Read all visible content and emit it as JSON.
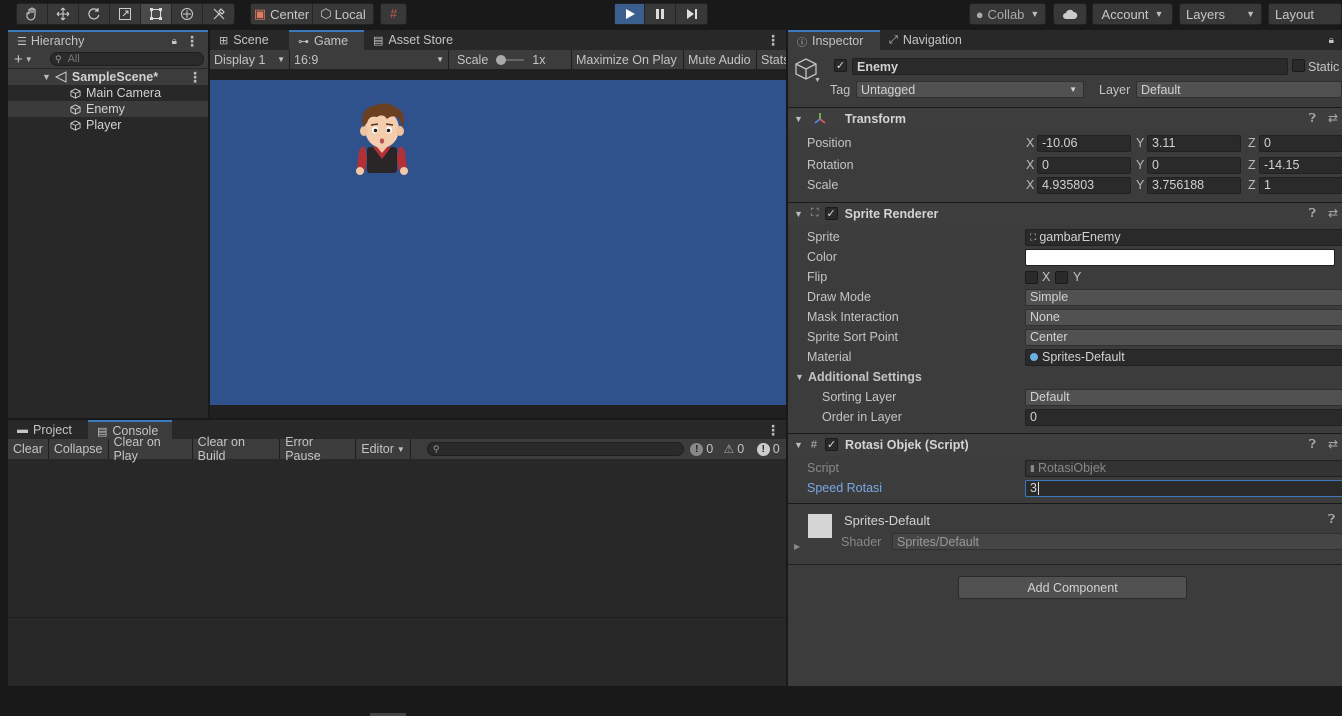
{
  "toolbar": {
    "pivot": "Center",
    "space": "Local",
    "collab": "Collab",
    "account": "Account",
    "layers": "Layers",
    "layout": "Layout"
  },
  "hierarchy": {
    "tab": "Hierarchy",
    "search_placeholder": "All",
    "scene": "SampleScene*",
    "items": [
      "Main Camera",
      "Enemy",
      "Player"
    ]
  },
  "center_tabs": [
    "Scene",
    "Game",
    "Asset Store"
  ],
  "game_bar": {
    "display": "Display 1",
    "aspect": "16:9",
    "scale_label": "Scale",
    "scale_value": "1x",
    "maximize": "Maximize On Play",
    "mute": "Mute Audio",
    "stats": "Stats"
  },
  "game_view": {
    "background": "#30528c"
  },
  "bottom_tabs": [
    "Project",
    "Console"
  ],
  "console_toolbar": {
    "clear": "Clear",
    "collapse": "Collapse",
    "clear_on_play": "Clear on Play",
    "clear_on_build": "Clear on Build",
    "error_pause": "Error Pause",
    "editor": "Editor",
    "count_info": "0",
    "count_warn": "0",
    "count_error": "0"
  },
  "inspector": {
    "tabs": [
      "Inspector",
      "Navigation"
    ],
    "object_name": "Enemy",
    "static_label": "Static",
    "tag_label": "Tag",
    "tag_value": "Untagged",
    "layer_label": "Layer",
    "layer_value": "Default",
    "transform": {
      "title": "Transform",
      "position_label": "Position",
      "rotation_label": "Rotation",
      "scale_label": "Scale",
      "position": {
        "x": "-10.06",
        "y": "3.11",
        "z": "0"
      },
      "rotation": {
        "x": "0",
        "y": "0",
        "z": "-14.15"
      },
      "scale": {
        "x": "4.935803",
        "y": "3.756188",
        "z": "1"
      }
    },
    "sprite_renderer": {
      "title": "Sprite Renderer",
      "sprite_label": "Sprite",
      "sprite_value": "gambarEnemy",
      "color_label": "Color",
      "flip_label": "Flip",
      "flip_x": "X",
      "flip_y": "Y",
      "draw_mode_label": "Draw Mode",
      "draw_mode_value": "Simple",
      "mask_label": "Mask Interaction",
      "mask_value": "None",
      "sort_point_label": "Sprite Sort Point",
      "sort_point_value": "Center",
      "material_label": "Material",
      "material_value": "Sprites-Default",
      "additional_label": "Additional Settings",
      "sorting_layer_label": "Sorting Layer",
      "sorting_layer_value": "Default",
      "order_label": "Order in Layer",
      "order_value": "0"
    },
    "script_comp": {
      "title": "Rotasi Objek (Script)",
      "script_label": "Script",
      "script_value": "RotasiObjek",
      "speed_label": "Speed Rotasi",
      "speed_value": "3"
    },
    "material": {
      "name": "Sprites-Default",
      "shader_label": "Shader",
      "shader_value": "Sprites/Default"
    },
    "add_component": "Add Component"
  }
}
